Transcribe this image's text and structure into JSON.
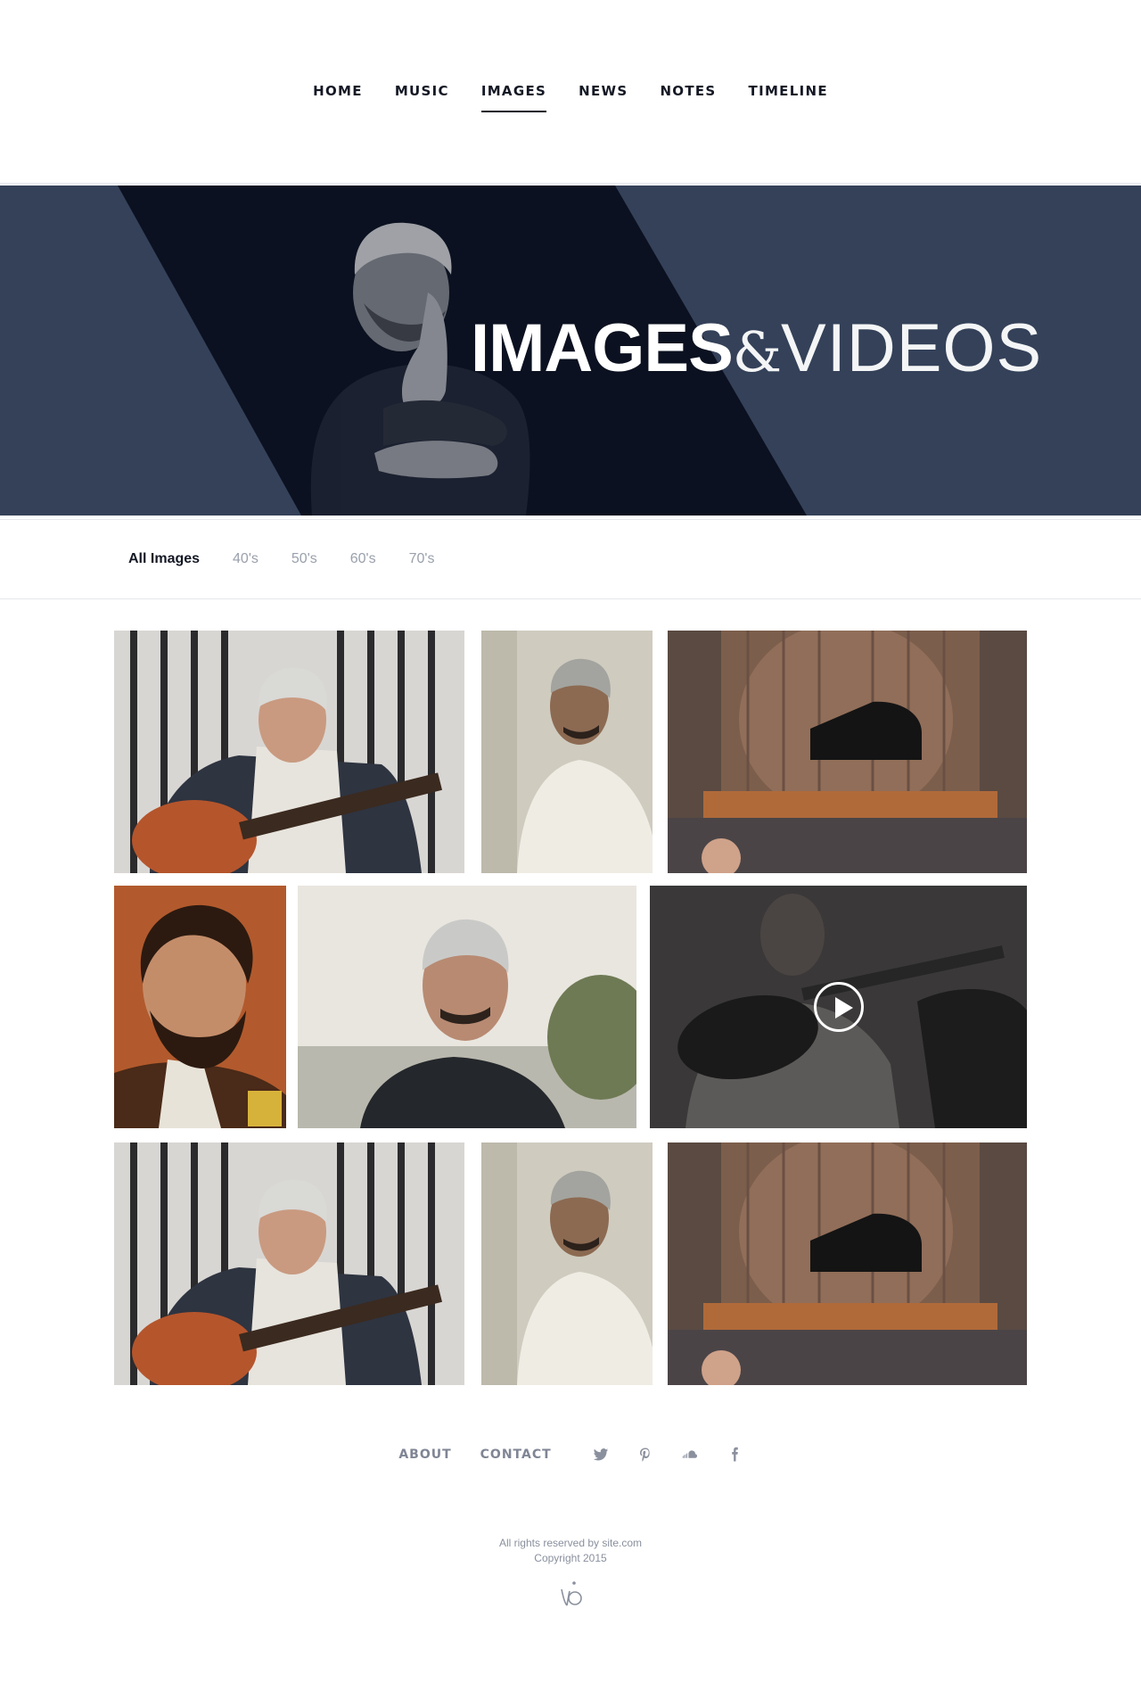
{
  "nav": {
    "items": [
      {
        "label": "HOME"
      },
      {
        "label": "MUSIC"
      },
      {
        "label": "IMAGES",
        "active": true
      },
      {
        "label": "NEWS"
      },
      {
        "label": "NOTES"
      },
      {
        "label": "TIMELINE"
      }
    ]
  },
  "hero": {
    "title_bold": "IMAGES",
    "title_amp": "&",
    "title_light": "VIDEOS"
  },
  "filters": {
    "items": [
      {
        "label": "All Images",
        "active": true
      },
      {
        "label": "40's"
      },
      {
        "label": "50's"
      },
      {
        "label": "60's"
      },
      {
        "label": "70's"
      }
    ]
  },
  "gallery": {
    "items": [
      {
        "kind": "image",
        "subject": "guitarist-at-window-bars"
      },
      {
        "kind": "image",
        "subject": "man-in-white-shirt"
      },
      {
        "kind": "image",
        "subject": "pianist-on-stage"
      },
      {
        "kind": "image",
        "subject": "bearded-portrait"
      },
      {
        "kind": "image",
        "subject": "man-outdoors-portrait"
      },
      {
        "kind": "video",
        "subject": "guitarist-playing",
        "icon": "play-icon"
      },
      {
        "kind": "image",
        "subject": "guitarist-at-window-bars"
      },
      {
        "kind": "image",
        "subject": "man-in-white-shirt"
      },
      {
        "kind": "image",
        "subject": "pianist-on-stage"
      }
    ]
  },
  "footer": {
    "about": "ABOUT",
    "contact": "CONTACT",
    "social": [
      "twitter-icon",
      "pinterest-icon",
      "soundcloud-icon",
      "facebook-icon"
    ],
    "rights": "All rights reserved by site.com",
    "copyright": "Copyright 2015"
  },
  "colors": {
    "hero_bg": "#344159",
    "hero_band": "#0b1120",
    "text_dark": "#141824",
    "text_muted": "#9aa0ab"
  }
}
